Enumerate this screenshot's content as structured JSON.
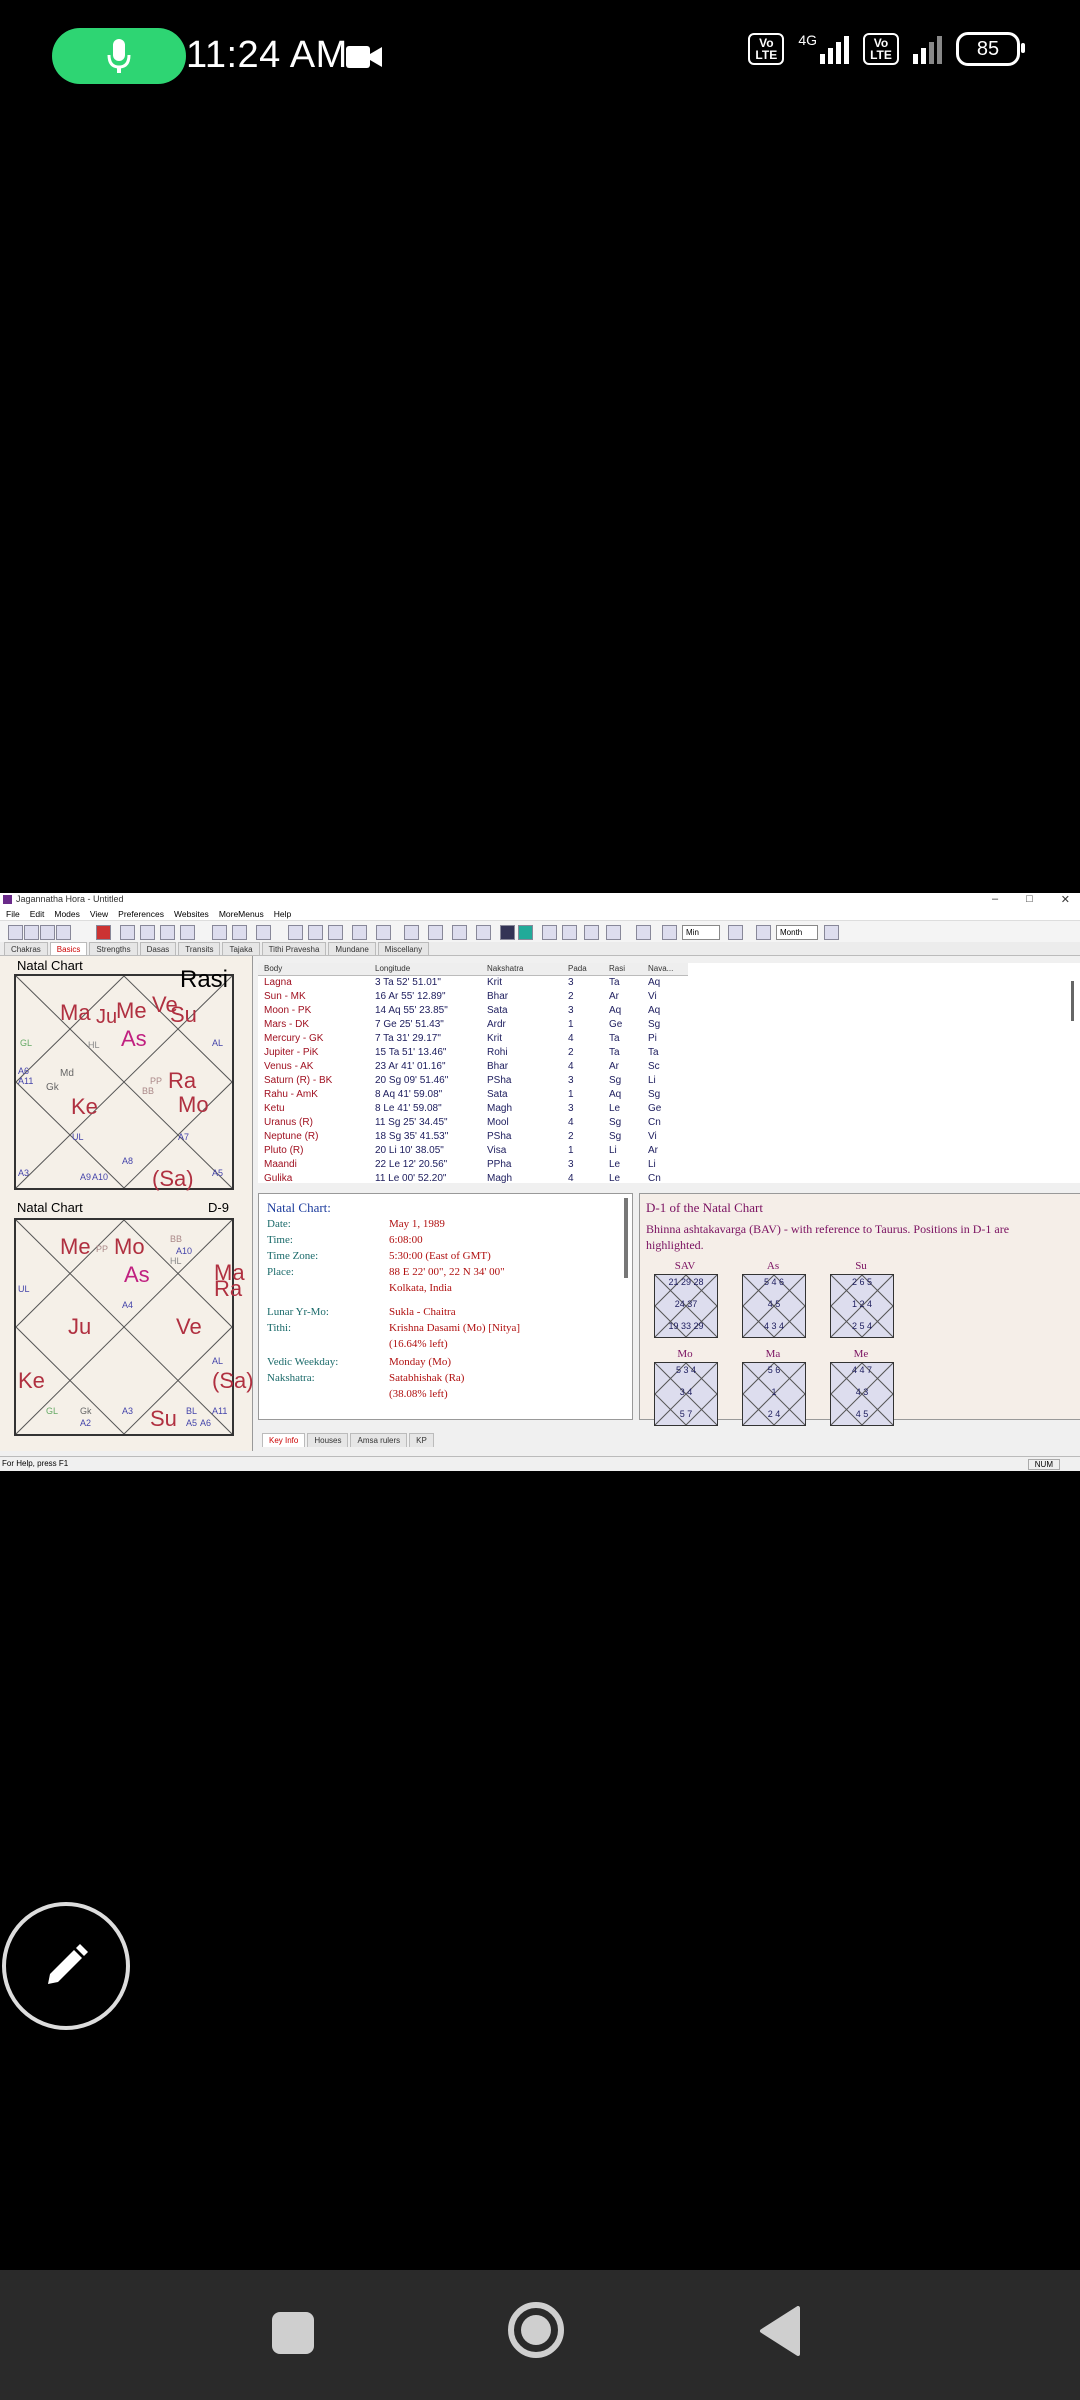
{
  "status_bar": {
    "time": "11:24 AM",
    "network": "4G",
    "volte": "Vo LTE",
    "battery": "85"
  },
  "app": {
    "title": "Jagannatha Hora - Untitled",
    "menu": [
      "File",
      "Edit",
      "Modes",
      "View",
      "Preferences",
      "Websites",
      "MoreMenus",
      "Help"
    ],
    "toolbar_selects": [
      "Min",
      "Month"
    ],
    "tabs": [
      "Chakras",
      "Basics",
      "Strengths",
      "Dasas",
      "Transits",
      "Tajaka",
      "Tithi Pravesha",
      "Mundane",
      "Miscellany"
    ],
    "active_tab": "Basics",
    "chart1": {
      "title": "Natal Chart",
      "type": "Rasi",
      "planets": [
        "Ma",
        "Ju",
        "Me",
        "Ve",
        "Su",
        "As",
        "Ke",
        "Ra",
        "Mo",
        "(Sa)"
      ],
      "small": [
        "GL",
        "Md",
        "Gk",
        "HL",
        "PP",
        "BB",
        "AL",
        "UL",
        "A7",
        "A5",
        "A3",
        "A6",
        "A11",
        "A9",
        "A10",
        "A8",
        "A4",
        "A2",
        "A1"
      ]
    },
    "chart2": {
      "title": "Natal Chart",
      "type": "D-9",
      "planets": [
        "Me",
        "Mo",
        "As",
        "Ma",
        "Ra",
        "Ju",
        "Ve",
        "Ke",
        "Su",
        "(Sa)"
      ],
      "small": [
        "PP",
        "BB",
        "A10",
        "HL",
        "UL",
        "A4",
        "AL",
        "Gk",
        "GL",
        "A3",
        "BL",
        "A2",
        "A11",
        "A5",
        "A6"
      ]
    },
    "planet_table": {
      "headers": [
        "Body",
        "Longitude",
        "Nakshatra",
        "Pada",
        "Rasi",
        "Nava..."
      ],
      "rows": [
        [
          "Lagna",
          "3 Ta 52' 51.01\"",
          "Krit",
          "3",
          "Ta",
          "Aq"
        ],
        [
          "Sun - MK",
          "16 Ar 55' 12.89\"",
          "Bhar",
          "2",
          "Ar",
          "Vi"
        ],
        [
          "Moon - PK",
          "14 Aq 55' 23.85\"",
          "Sata",
          "3",
          "Aq",
          "Aq"
        ],
        [
          "Mars - DK",
          "7 Ge 25' 51.43\"",
          "Ardr",
          "1",
          "Ge",
          "Sg"
        ],
        [
          "Mercury - GK",
          "7 Ta 31' 29.17\"",
          "Krit",
          "4",
          "Ta",
          "Pi"
        ],
        [
          "Jupiter - PiK",
          "15 Ta 51' 13.46\"",
          "Rohi",
          "2",
          "Ta",
          "Ta"
        ],
        [
          "Venus - AK",
          "23 Ar 41' 01.16\"",
          "Bhar",
          "4",
          "Ar",
          "Sc"
        ],
        [
          "Saturn (R) - BK",
          "20 Sg 09' 51.46\"",
          "PSha",
          "3",
          "Sg",
          "Li"
        ],
        [
          "Rahu - AmK",
          "8 Aq 41' 59.08\"",
          "Sata",
          "1",
          "Aq",
          "Sg"
        ],
        [
          "Ketu",
          "8 Le 41' 59.08\"",
          "Magh",
          "3",
          "Le",
          "Ge"
        ],
        [
          "Uranus (R)",
          "11 Sg 25' 34.45\"",
          "Mool",
          "4",
          "Sg",
          "Cn"
        ],
        [
          "Neptune (R)",
          "18 Sg 35' 41.53\"",
          "PSha",
          "2",
          "Sg",
          "Vi"
        ],
        [
          "Pluto (R)",
          "20 Li 10' 38.05\"",
          "Visa",
          "1",
          "Li",
          "Ar"
        ],
        [
          "Maandi",
          "22 Le 12' 20.56\"",
          "PPha",
          "3",
          "Le",
          "Li"
        ],
        [
          "Gulika",
          "11 Le 00' 52.20\"",
          "Magh",
          "4",
          "Le",
          "Cn"
        ]
      ]
    },
    "key_info": {
      "heading": "Natal Chart:",
      "items": [
        {
          "k": "Date:",
          "v": "May 1, 1989"
        },
        {
          "k": "Time:",
          "v": "6:08:00"
        },
        {
          "k": "Time Zone:",
          "v": "5:30:00 (East of GMT)"
        },
        {
          "k": "Place:",
          "v": "88 E 22' 00\", 22 N 34' 00\""
        },
        {
          "k": "",
          "v": "Kolkata, India"
        },
        {
          "k": "Lunar Yr-Mo:",
          "v": "Sukla - Chaitra"
        },
        {
          "k": "Tithi:",
          "v": "Krishna Dasami (Mo) [Nitya]"
        },
        {
          "k": "",
          "v": "(16.64% left)"
        },
        {
          "k": "Vedic Weekday:",
          "v": "Monday (Mo)"
        },
        {
          "k": "Nakshatra:",
          "v": "Satabhishak (Ra)"
        },
        {
          "k": "",
          "v": "(38.08% left)"
        }
      ]
    },
    "bav": {
      "heading": "D-1 of the Natal Chart",
      "sub": "Bhinna ashtakavarga (BAV) - with reference to Taurus. Positions in D-1 are highlighted.",
      "charts": [
        {
          "label": "SAV",
          "center": "24 37",
          "top": "21 29 28",
          "bottom": "19 33 29"
        },
        {
          "label": "As",
          "center": "4 5",
          "top": "5 4 6",
          "bottom": "4 3 4"
        },
        {
          "label": "Su",
          "center": "1 2 4",
          "top": "2 6 5",
          "bottom": "2 5 4"
        },
        {
          "label": "Mo",
          "center": "3 4",
          "top": "5 3 4",
          "bottom": "5 7"
        },
        {
          "label": "Ma",
          "center": "1",
          "top": "5 6",
          "bottom": "2 4"
        },
        {
          "label": "Me",
          "center": "4 3",
          "top": "4 4 7",
          "bottom": "4 5"
        }
      ]
    },
    "bottom_tabs": [
      "Key Info",
      "Houses",
      "Amsa rulers",
      "KP"
    ],
    "active_bottom_tab": "Key Info",
    "status_left": "For Help, press F1",
    "status_right": "NUM"
  }
}
